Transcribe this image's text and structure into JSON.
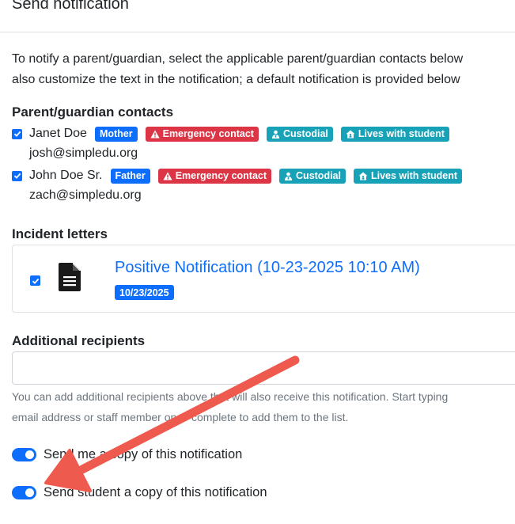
{
  "header": {
    "title": "Send notification"
  },
  "intro": {
    "line1": "To notify a parent/guardian, select the applicable parent/guardian contacts below",
    "line2": "also customize the text in the notification; a default notification is provided below"
  },
  "contacts": {
    "heading": "Parent/guardian contacts",
    "items": [
      {
        "name": "Janet Doe",
        "email": "josh@simpledu.org",
        "relation": "Mother",
        "badges": [
          "Emergency contact",
          "Custodial",
          "Lives with student"
        ],
        "checked": true
      },
      {
        "name": "John Doe Sr.",
        "email": "zach@simpledu.org",
        "relation": "Father",
        "badges": [
          "Emergency contact",
          "Custodial",
          "Lives with student"
        ],
        "checked": true
      }
    ]
  },
  "letters": {
    "heading": "Incident letters",
    "items": [
      {
        "title": "Positive Notification (10-23-2025 10:10 AM)",
        "date": "10/23/2025",
        "checked": true
      }
    ]
  },
  "recipients": {
    "heading": "Additional recipients",
    "value": "",
    "help_line1": "You can add additional recipients above that will also receive this notification. Start typing",
    "help_line2": "email address or staff member once complete to add them to the list."
  },
  "toggles": {
    "copy_self": {
      "label": "Send me a copy of this notification",
      "on": true
    },
    "copy_student": {
      "label": "Send student a copy of this notification",
      "on": true
    }
  },
  "colors": {
    "primary": "#0d6efd",
    "danger": "#dc3545",
    "info": "#17a2b8",
    "annotation_arrow": "#ef5a4e"
  },
  "icons": {
    "emergency": "warning-triangle-icon",
    "custodial": "guardian-icon",
    "lives_with": "home-icon",
    "letter": "document-icon"
  }
}
